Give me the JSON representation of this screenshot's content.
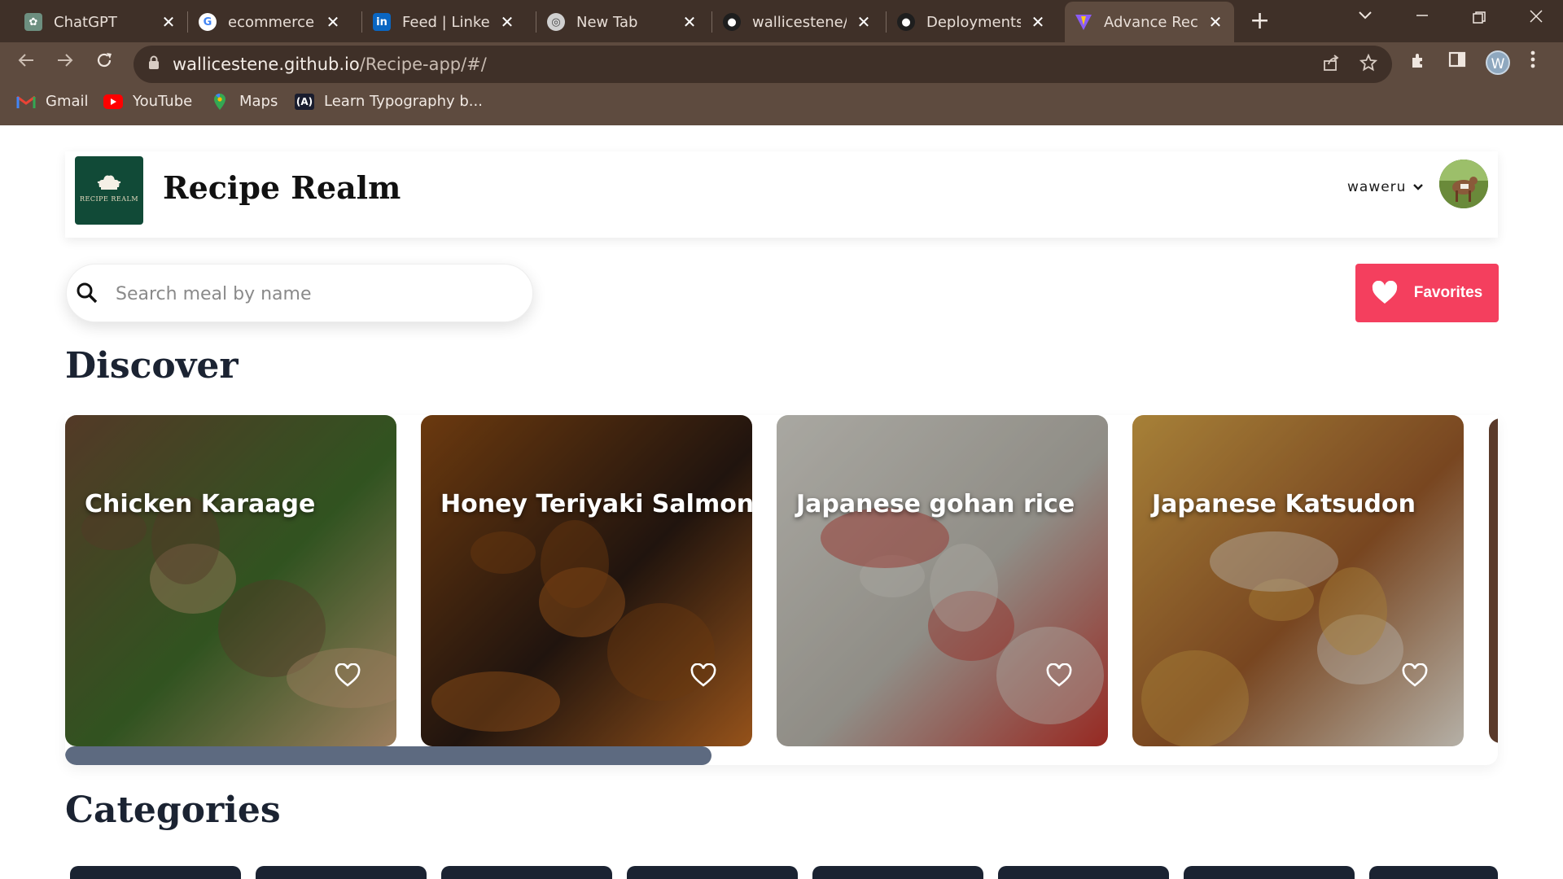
{
  "browser": {
    "tabs": [
      {
        "title": "ChatGPT",
        "icon": "chatgpt-icon",
        "active": false
      },
      {
        "title": "ecommerce we",
        "icon": "google-icon",
        "active": false
      },
      {
        "title": "Feed | LinkedIn",
        "icon": "linkedin-icon",
        "active": false
      },
      {
        "title": "New Tab",
        "icon": "chrome-icon",
        "active": false
      },
      {
        "title": "wallicestene/R",
        "icon": "github-icon",
        "active": false
      },
      {
        "title": "Deployments ·",
        "icon": "github-icon",
        "active": false
      },
      {
        "title": "Advance Recip",
        "icon": "vite-icon",
        "active": true
      }
    ],
    "close_glyph": "✕",
    "new_tab_glyph": "+",
    "url_host": "wallicestene.github.io",
    "url_path": "/Recipe-app/#/",
    "profile_initial": "W",
    "bookmarks": [
      {
        "label": "Gmail",
        "icon": "gmail-icon"
      },
      {
        "label": "YouTube",
        "icon": "youtube-icon"
      },
      {
        "label": "Maps",
        "icon": "maps-icon"
      },
      {
        "label": "Learn Typography b...",
        "icon": "typography-icon"
      }
    ]
  },
  "header": {
    "brand": "Recipe Realm",
    "logo_text": "RECIPE REALM",
    "username": "waweru"
  },
  "search": {
    "placeholder": "Search meal by name"
  },
  "favorites_label": "Favorites",
  "discover": {
    "title": "Discover",
    "meals": [
      {
        "name": "Chicken Karaage",
        "theme": [
          "#6b4a32",
          "#3f6b2a",
          "#c9a27a"
        ]
      },
      {
        "name": "Honey Teriyaki Salmon",
        "theme": [
          "#8a4a14",
          "#2a1a12",
          "#c06a22"
        ]
      },
      {
        "name": "Japanese gohan rice",
        "theme": [
          "#d9d7cf",
          "#b8b5ac",
          "#c2352c"
        ]
      },
      {
        "name": "Japanese Katsudon",
        "theme": [
          "#d6a548",
          "#9a5a2a",
          "#e8e2d6"
        ]
      }
    ]
  },
  "categories": {
    "title": "Categories"
  },
  "colors": {
    "accent": "#f43f5e",
    "heading": "#1b2332",
    "logo_bg": "#114a37",
    "scrollbar": "#5d6a80"
  }
}
